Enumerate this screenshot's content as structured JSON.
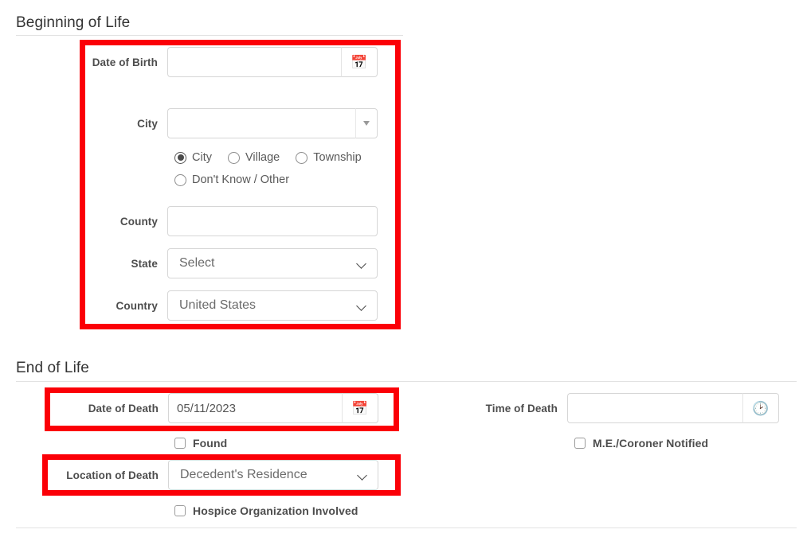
{
  "sections": {
    "beginning": {
      "title": "Beginning of Life",
      "date_of_birth": {
        "label": "Date of Birth",
        "value": "",
        "icon": "calendar-icon",
        "icon_glyph": "📅"
      },
      "city": {
        "label": "City",
        "value": "",
        "caret_icon": "caret-down-icon"
      },
      "city_type_options": [
        {
          "label": "City",
          "selected": true
        },
        {
          "label": "Village",
          "selected": false
        },
        {
          "label": "Township",
          "selected": false
        },
        {
          "label": "Don't Know / Other",
          "selected": false
        }
      ],
      "county": {
        "label": "County",
        "value": ""
      },
      "state": {
        "label": "State",
        "value": "Select",
        "icon": "chevron-down-icon"
      },
      "country": {
        "label": "Country",
        "value": "United States",
        "icon": "chevron-down-icon"
      }
    },
    "end": {
      "title": "End of Life",
      "date_of_death": {
        "label": "Date of Death",
        "value": "05/11/2023",
        "icon": "calendar-icon",
        "icon_glyph": "📅"
      },
      "time_of_death": {
        "label": "Time of Death",
        "value": "",
        "icon": "clock-icon",
        "icon_glyph": "🕑"
      },
      "found": {
        "label": "Found",
        "checked": false
      },
      "me_coroner_notified": {
        "label": "M.E./Coroner Notified",
        "checked": false
      },
      "location_of_death": {
        "label": "Location of Death",
        "value": "Decedent's Residence",
        "icon": "chevron-down-icon"
      },
      "hospice_involved": {
        "label": "Hospice Organization Involved",
        "checked": false
      }
    }
  },
  "annotations": {
    "highlight_color": "#fb0007",
    "boxes": [
      {
        "name": "beginning-of-life-highlight"
      },
      {
        "name": "date-of-death-highlight"
      },
      {
        "name": "location-of-death-highlight"
      }
    ]
  }
}
